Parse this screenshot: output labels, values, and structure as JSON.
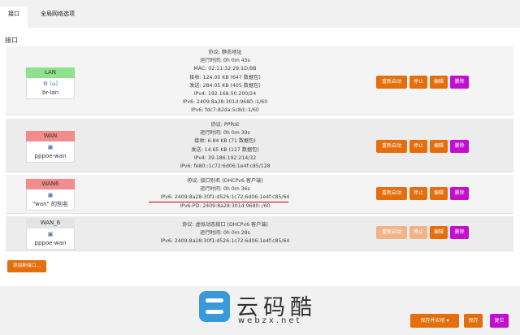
{
  "tabs": [
    {
      "label": "接口"
    },
    {
      "label": "全局网络选项"
    }
  ],
  "section_title": "接口",
  "interfaces": [
    {
      "name": "LAN",
      "head_color": "#8ce38c",
      "icons": "⚙ (⌂)",
      "device": "br-lan",
      "info": [
        "协议: 静态地址",
        "运行时间: 0h 0m 43s",
        "MAC: 02:11:32:29:1D:BB",
        "接收: 124.00 KB (647 数据包)",
        "发送: 284.05 KB (405 数据包)",
        "IPv4: 192.168.50.200/24",
        "IPv6: 2409:8a28:301d:9680::1/60",
        "IPv6: fdc7:82da:5c8d::1/60"
      ]
    },
    {
      "name": "WAN",
      "head_color": "#f28b8b",
      "icons": "▣",
      "device": "pppoe-wan",
      "info": [
        "协议: PPPoE",
        "运行时间: 0h 0m 39s",
        "接收: 6.84 KB (71 数据包)",
        "发送: 14.65 KB (127 数据包)",
        "IPv4: 39.186.192.214/32",
        "IPv6: fe80::1c72:6d06:1e4f:c85/128"
      ]
    },
    {
      "name": "WAN6",
      "head_color": "#f28b8b",
      "icons": "▣",
      "device": "\"wan\" 的别名",
      "info": [
        "协议: 接口别名 (DHCPv6 客户端)",
        "运行时间: 0h 0m 36s",
        "IPv6: 2409:8a28:30f1:d526:1c72:6d06:1e4f:c85/64",
        "IPv6-PD: 2409:8a28:301d:9680::/60"
      ]
    },
    {
      "name": "WAN_6",
      "head_color": "#e4e4e4",
      "icons": "▣",
      "device": "pppoe-wan",
      "info": [
        "协议: 虚拟动态接口 (DHCPv6 客户端)",
        "运行时间: 0h 0m 28s",
        "IPv6: 2409:8a28:30f1:d526:1c72:6d06:1e4f:c85/64"
      ]
    }
  ],
  "row_buttons": {
    "restart": "重新启动",
    "stop": "停止",
    "edit": "编辑",
    "delete": "删除"
  },
  "add_button": "添加新接口...",
  "watermark": {
    "cn": "云码酷",
    "en": "webzx.net"
  },
  "bottom_buttons": {
    "apply": "保存并应用 ▾",
    "save": "保存",
    "reset": "复位"
  }
}
